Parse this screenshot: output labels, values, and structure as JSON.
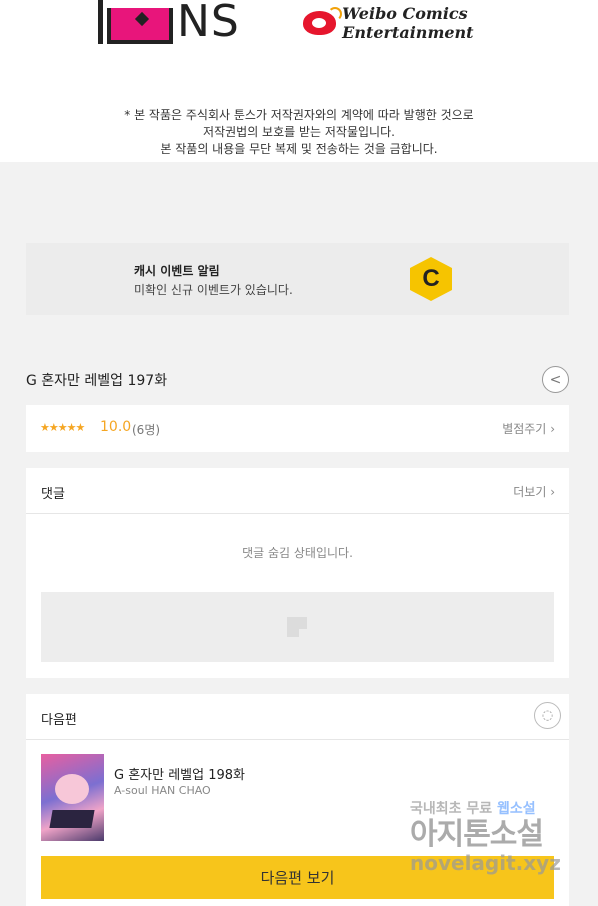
{
  "header": {
    "publisher_logo_text": "NS",
    "partner_logo_text": "Weibo Comics Entertainment",
    "notice_lines": [
      "* 본 작품은 주식회사 툰스가 저작권자와의 계약에 따라 발행한 것으로",
      "저작권법의 보호를 받는 저작물입니다.",
      "본 작품의 내용을 무단 복제 및 전송하는 것을 금합니다."
    ]
  },
  "cash_event": {
    "title": "캐시 이벤트 알림",
    "subtitle": "미확인 신규 이벤트가 있습니다.",
    "coin_letter": "C",
    "coin_color": "#f6c400"
  },
  "episode": {
    "title": "G 혼자만 레벨업 197화",
    "share_icon": "share-icon"
  },
  "rating": {
    "stars": "★★★★★",
    "score": "10.0",
    "count": "(6명)",
    "rate_link": "별점주기",
    "star_color": "#f5a623"
  },
  "comments": {
    "title": "댓글",
    "more_link": "더보기",
    "hidden_message": "댓글 숨김 상태입니다."
  },
  "next_episode": {
    "section_title": "다음편",
    "title": "G 혼자만 레벨업 198화",
    "author": "A-soul HAN CHAO",
    "button_label": "다음편 보기",
    "button_color": "#f7c51b"
  },
  "watermark": {
    "line1_prefix": "국내최초 무료 ",
    "line1_highlight": "웹소설",
    "line2": "아지톤소설",
    "line3": "novelagit.xyz"
  }
}
